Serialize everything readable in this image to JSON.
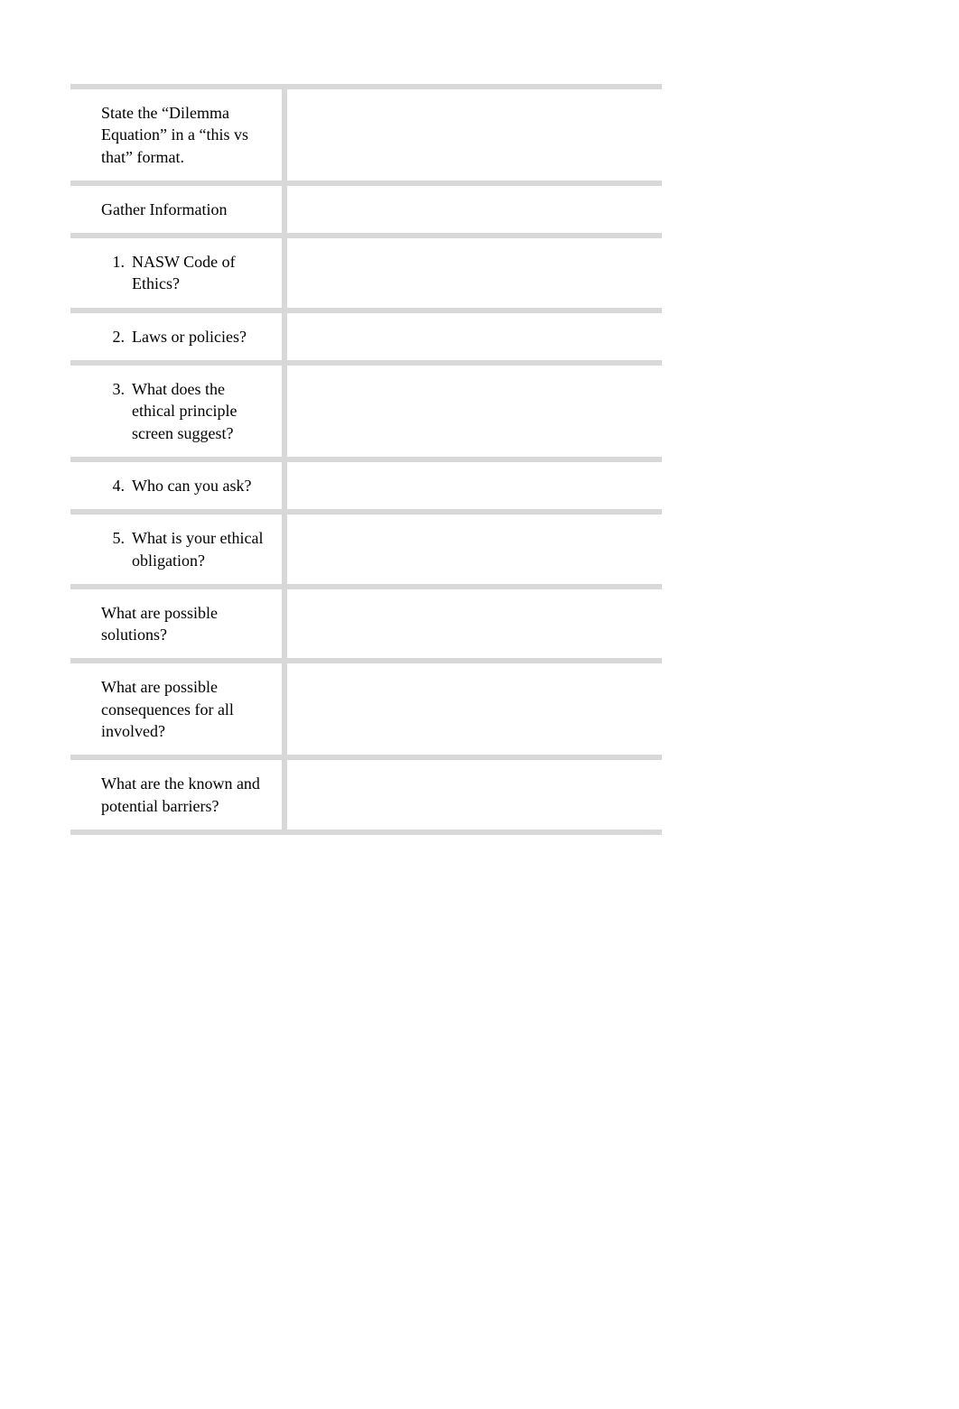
{
  "bullet_glyph": "",
  "rows": [
    {
      "type": "bullet",
      "text": "State the “Dilemma Equation” in a “this vs that” format."
    },
    {
      "type": "bullet",
      "text": "Gather Information"
    },
    {
      "type": "number",
      "num": "1.",
      "text": "NASW Code of Ethics?"
    },
    {
      "type": "number",
      "num": "2.",
      "text": "Laws or policies?"
    },
    {
      "type": "number",
      "num": "3.",
      "text": "What does the ethical principle screen suggest?"
    },
    {
      "type": "number",
      "num": "4.",
      "text": "Who can you ask?"
    },
    {
      "type": "number",
      "num": "5.",
      "text": "What is your ethical obligation?"
    },
    {
      "type": "bullet",
      "text": "What are possible solutions?"
    },
    {
      "type": "bullet",
      "text": "What are possible consequences for all involved?"
    },
    {
      "type": "bullet",
      "text": "What are the known and potential barriers?"
    }
  ]
}
